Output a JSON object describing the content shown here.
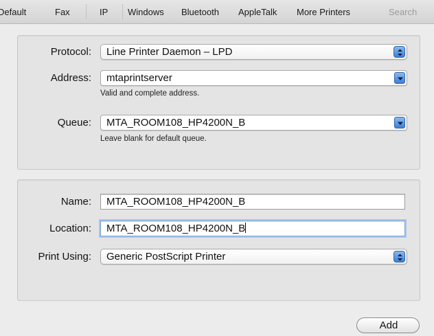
{
  "toolbar": {
    "tabs": [
      "Default",
      "Fax",
      "IP",
      "Windows",
      "Bluetooth",
      "AppleTalk",
      "More Printers"
    ],
    "search_placeholder": "Search"
  },
  "connection": {
    "protocol_label": "Protocol:",
    "protocol_value": "Line Printer Daemon – LPD",
    "address_label": "Address:",
    "address_value": "mtaprintserver",
    "address_hint": "Valid and complete address.",
    "queue_label": "Queue:",
    "queue_value": "MTA_ROOM108_HP4200N_B",
    "queue_hint": "Leave blank for default queue."
  },
  "details": {
    "name_label": "Name:",
    "name_value": "MTA_ROOM108_HP4200N_B",
    "location_label": "Location:",
    "location_value": "MTA_ROOM108_HP4200N_B",
    "print_using_label": "Print Using:",
    "print_using_value": "Generic PostScript Printer"
  },
  "actions": {
    "add_label": "Add"
  },
  "icons": {
    "popup_arrows": "updown-arrows-icon",
    "combo_arrow": "chevron-down-icon"
  },
  "colors": {
    "accent": "#3d7fd6",
    "focus_ring": "#a9c7ec"
  }
}
